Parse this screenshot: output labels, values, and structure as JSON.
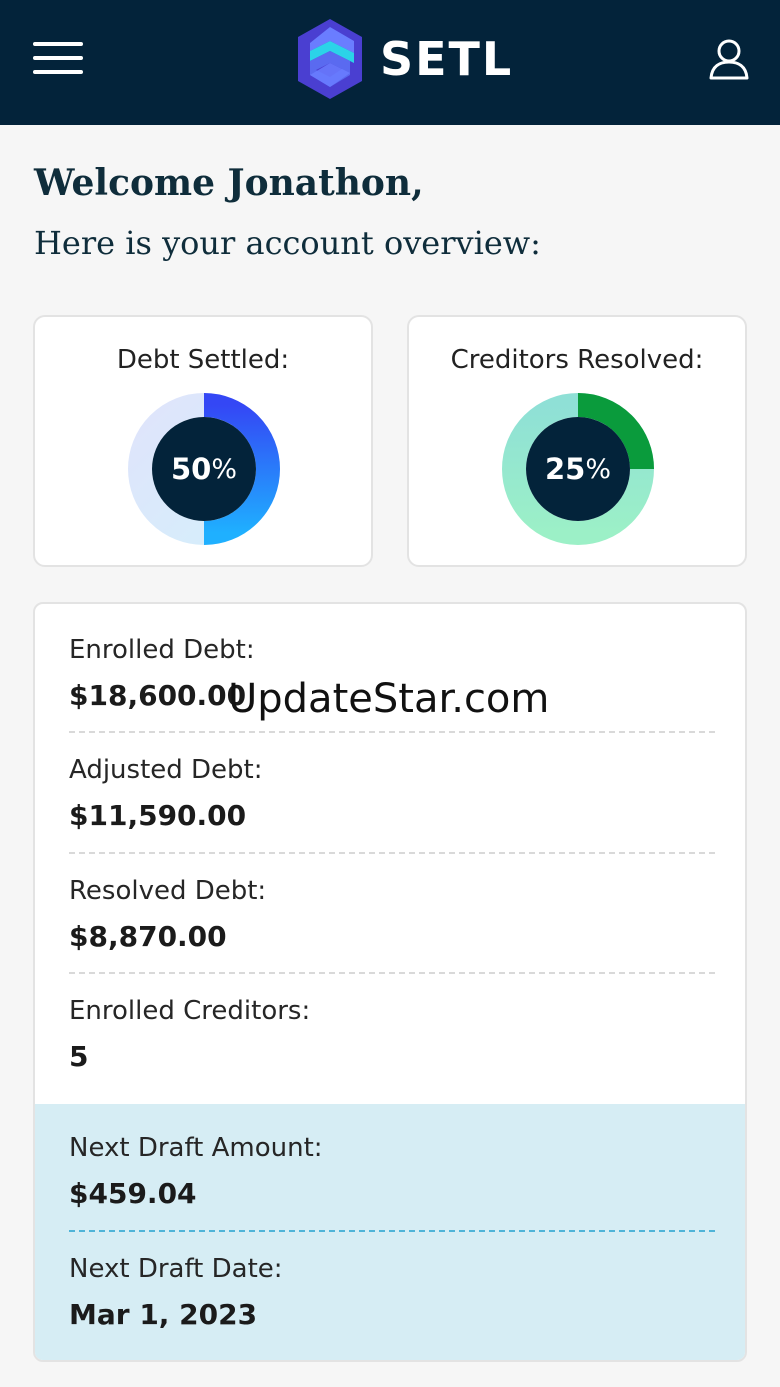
{
  "header": {
    "brand": "SETL",
    "colors": {
      "background": "#03233a",
      "logo_light": "#6a7dff",
      "logo_dark": "#4a3fd1",
      "logo_teal": "#2bd3e8"
    }
  },
  "greeting": {
    "welcome": "Welcome Jonathon,",
    "subtitle": "Here is your account overview:"
  },
  "stats": {
    "debt_settled": {
      "title": "Debt Settled:",
      "number": "50",
      "unit": "%",
      "fraction": 0.5,
      "color": "#2b6cff"
    },
    "creditors_resolved": {
      "title": "Creditors Resolved:",
      "number": "25",
      "unit": "%",
      "fraction": 0.25,
      "color": "#0a9b3c"
    }
  },
  "details": {
    "enrolled_debt": {
      "label": "Enrolled Debt:",
      "value": "$18,600.00"
    },
    "watermark": "UpdateStar.com",
    "adjusted_debt": {
      "label": "Adjusted Debt:",
      "value": "$11,590.00"
    },
    "resolved_debt": {
      "label": "Resolved Debt:",
      "value": "$8,870.00"
    },
    "enrolled_creditors": {
      "label": "Enrolled Creditors:",
      "value": "5"
    },
    "next_draft_amount": {
      "label": "Next Draft Amount:",
      "value": "$459.04"
    },
    "next_draft_date": {
      "label": "Next Draft Date:",
      "value": "Mar 1, 2023"
    }
  }
}
